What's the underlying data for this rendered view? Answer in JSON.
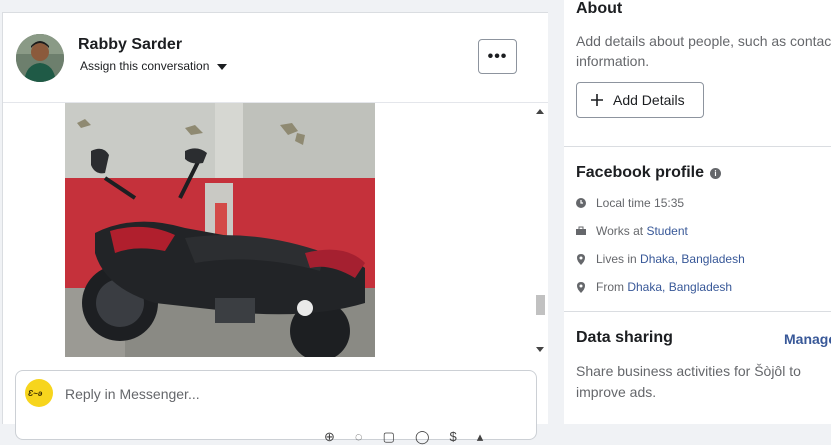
{
  "conversation": {
    "contact_name": "Rabby Sarder",
    "assign_label": "Assign this conversation",
    "more_label": "•••"
  },
  "reply": {
    "placeholder": "Reply in Messenger..."
  },
  "about": {
    "title": "About",
    "description_line1": "Add details about people, such as contact",
    "description_line2": "information.",
    "add_details_label": "Add Details"
  },
  "facebook_profile": {
    "title": "Facebook profile",
    "local_time": "Local time 15:35",
    "works_prefix": "Works at ",
    "works_link": "Student",
    "lives_prefix": "Lives in ",
    "lives_link": "Dhaka, Bangladesh",
    "from_prefix": "From ",
    "from_link": "Dhaka, Bangladesh"
  },
  "data_sharing": {
    "title": "Data sharing",
    "manage_label": "Manage",
    "description_line1": "Share business activities for Šòjôl to",
    "description_line2": "improve ads."
  },
  "colors": {
    "link": "#385898",
    "panel_bg": "#f0f2f5"
  }
}
